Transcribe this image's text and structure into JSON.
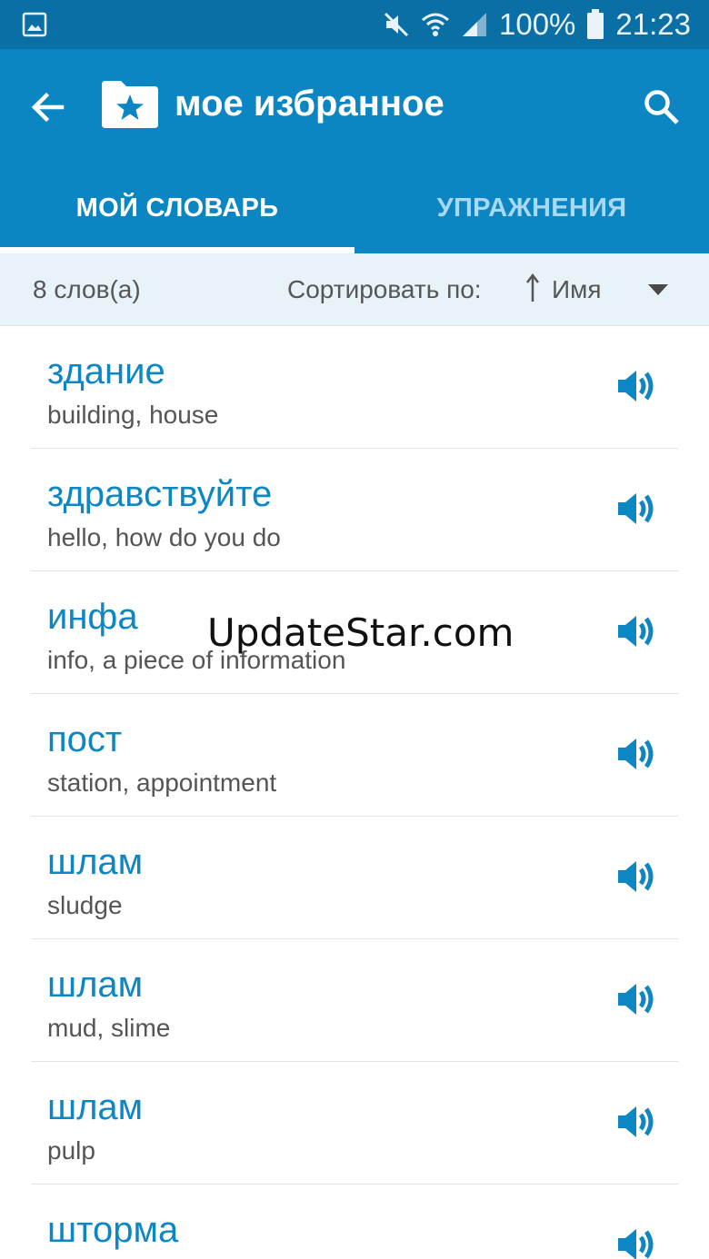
{
  "status_bar": {
    "battery": "100%",
    "time": "21:23",
    "icons": [
      "gallery-icon",
      "mute-icon",
      "wifi-icon",
      "signal-icon",
      "battery-icon"
    ]
  },
  "header": {
    "title": "мое избранное",
    "back_icon": "arrow-left-icon",
    "folder_icon": "star-folder-icon",
    "search_icon": "search-icon"
  },
  "tabs": [
    {
      "label": "МОЙ СЛОВАРЬ",
      "active": true
    },
    {
      "label": "УПРАЖНЕНИЯ",
      "active": false
    }
  ],
  "sort_bar": {
    "count": "8 слов(а)",
    "label": "Сортировать по:",
    "value": "Имя",
    "direction": "ascending"
  },
  "words": [
    {
      "word": "здание",
      "translation": "building, house"
    },
    {
      "word": "здравствуйте",
      "translation": "hello, how do you do"
    },
    {
      "word": "инфа",
      "translation": "info, a piece of information"
    },
    {
      "word": "пост",
      "translation": "station, appointment"
    },
    {
      "word": "шлам",
      "translation": "sludge"
    },
    {
      "word": "шлам",
      "translation": "mud, slime"
    },
    {
      "word": "шлам",
      "translation": "pulp"
    },
    {
      "word": "шторма",
      "translation": ""
    }
  ],
  "watermark": "UpdateStar.com",
  "colors": {
    "status_bar": "#0a6fa5",
    "app_bar": "#0b86c3",
    "accent_text": "#0d86c4",
    "sort_bar_bg": "#e8f3f9"
  }
}
